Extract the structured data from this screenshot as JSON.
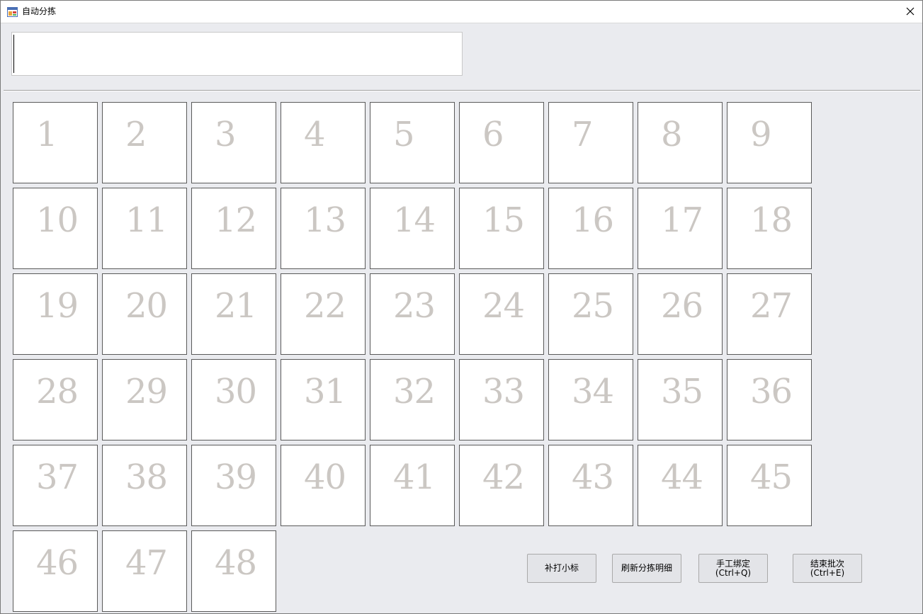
{
  "window": {
    "title": "自动分拣",
    "icons": {
      "app": "app-window-icon",
      "close": "close-icon"
    }
  },
  "scan_input": {
    "value": "",
    "placeholder": ""
  },
  "slots": [
    "1",
    "2",
    "3",
    "4",
    "5",
    "6",
    "7",
    "8",
    "9",
    "10",
    "11",
    "12",
    "13",
    "14",
    "15",
    "16",
    "17",
    "18",
    "19",
    "20",
    "21",
    "22",
    "23",
    "24",
    "25",
    "26",
    "27",
    "28",
    "29",
    "30",
    "31",
    "32",
    "33",
    "34",
    "35",
    "36",
    "37",
    "38",
    "39",
    "40",
    "41",
    "42",
    "43",
    "44",
    "45",
    "46",
    "47",
    "48"
  ],
  "buttons": {
    "reprint": {
      "label": "补打小标"
    },
    "refresh": {
      "label": "刷新分拣明细"
    },
    "manual_bind": {
      "label": "手工绑定",
      "shortcut": "(Ctrl+Q)"
    },
    "end_batch": {
      "label": "结束批次",
      "shortcut": "(Ctrl+E)"
    }
  },
  "colors": {
    "window_bg": "#eaebef",
    "slot_number": "#cbc7c3",
    "slot_border": "#5a5a5a"
  }
}
